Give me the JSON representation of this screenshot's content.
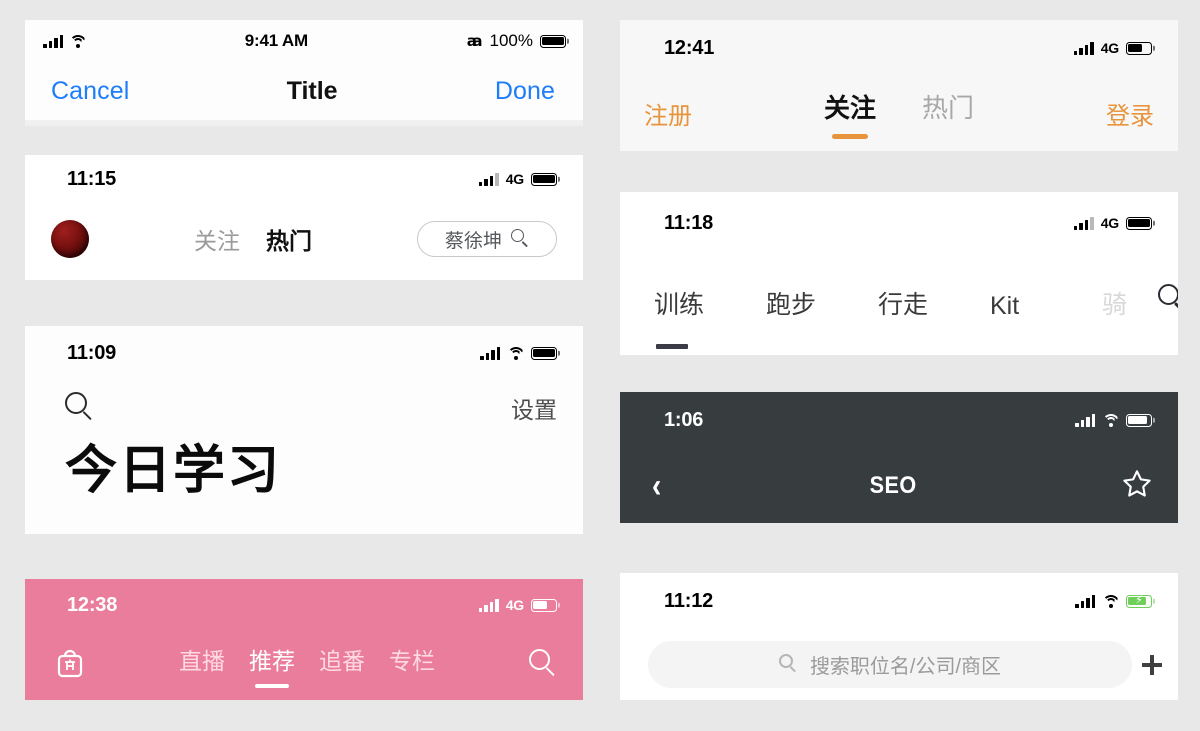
{
  "colors": {
    "page_background": "#e8e8e8",
    "ios_blue": "#1d7dfb",
    "bilibili_pink": "#ea7d9c",
    "accent_orange": "#e8943c",
    "dark_navbar": "#373c3f",
    "battery_green": "#6fcf5a"
  },
  "panels": {
    "p1_ios_title": {
      "status": {
        "time": "9:41 AM",
        "battery_percent": "100%"
      },
      "nav": {
        "cancel": "Cancel",
        "title": "Title",
        "done": "Done"
      }
    },
    "p2_douyin": {
      "status": {
        "time": "11:15",
        "network": "4G"
      },
      "tabs": [
        {
          "label": "关注",
          "active": false
        },
        {
          "label": "热门",
          "active": true
        }
      ],
      "search_pill": {
        "value": "蔡徐坤"
      }
    },
    "p3_study": {
      "status": {
        "time": "11:09"
      },
      "settings_label": "设置",
      "heading": "今日学习"
    },
    "p4_bilibili": {
      "status": {
        "time": "12:38",
        "network": "4G"
      },
      "tabs": [
        {
          "label": "直播",
          "active": false
        },
        {
          "label": "推荐",
          "active": true
        },
        {
          "label": "追番",
          "active": false
        },
        {
          "label": "专栏",
          "active": false
        }
      ]
    },
    "p5_orange": {
      "status": {
        "time": "12:41",
        "network": "4G"
      },
      "left_action": "注册",
      "right_action": "登录",
      "tabs": [
        {
          "label": "关注",
          "active": true
        },
        {
          "label": "热门",
          "active": false
        }
      ]
    },
    "p6_fitness": {
      "status": {
        "time": "11:18",
        "network": "4G"
      },
      "tabs": [
        {
          "label": "训练",
          "active": true
        },
        {
          "label": "跑步",
          "active": false
        },
        {
          "label": "行走",
          "active": false
        },
        {
          "label": "Kit",
          "active": false
        },
        {
          "label": "骑",
          "active": false
        }
      ]
    },
    "p7_seo": {
      "status": {
        "time": "1:06"
      },
      "title": "SEO"
    },
    "p8_jobs": {
      "status": {
        "time": "11:12"
      },
      "search": {
        "placeholder": "搜索职位名/公司/商区"
      }
    }
  }
}
